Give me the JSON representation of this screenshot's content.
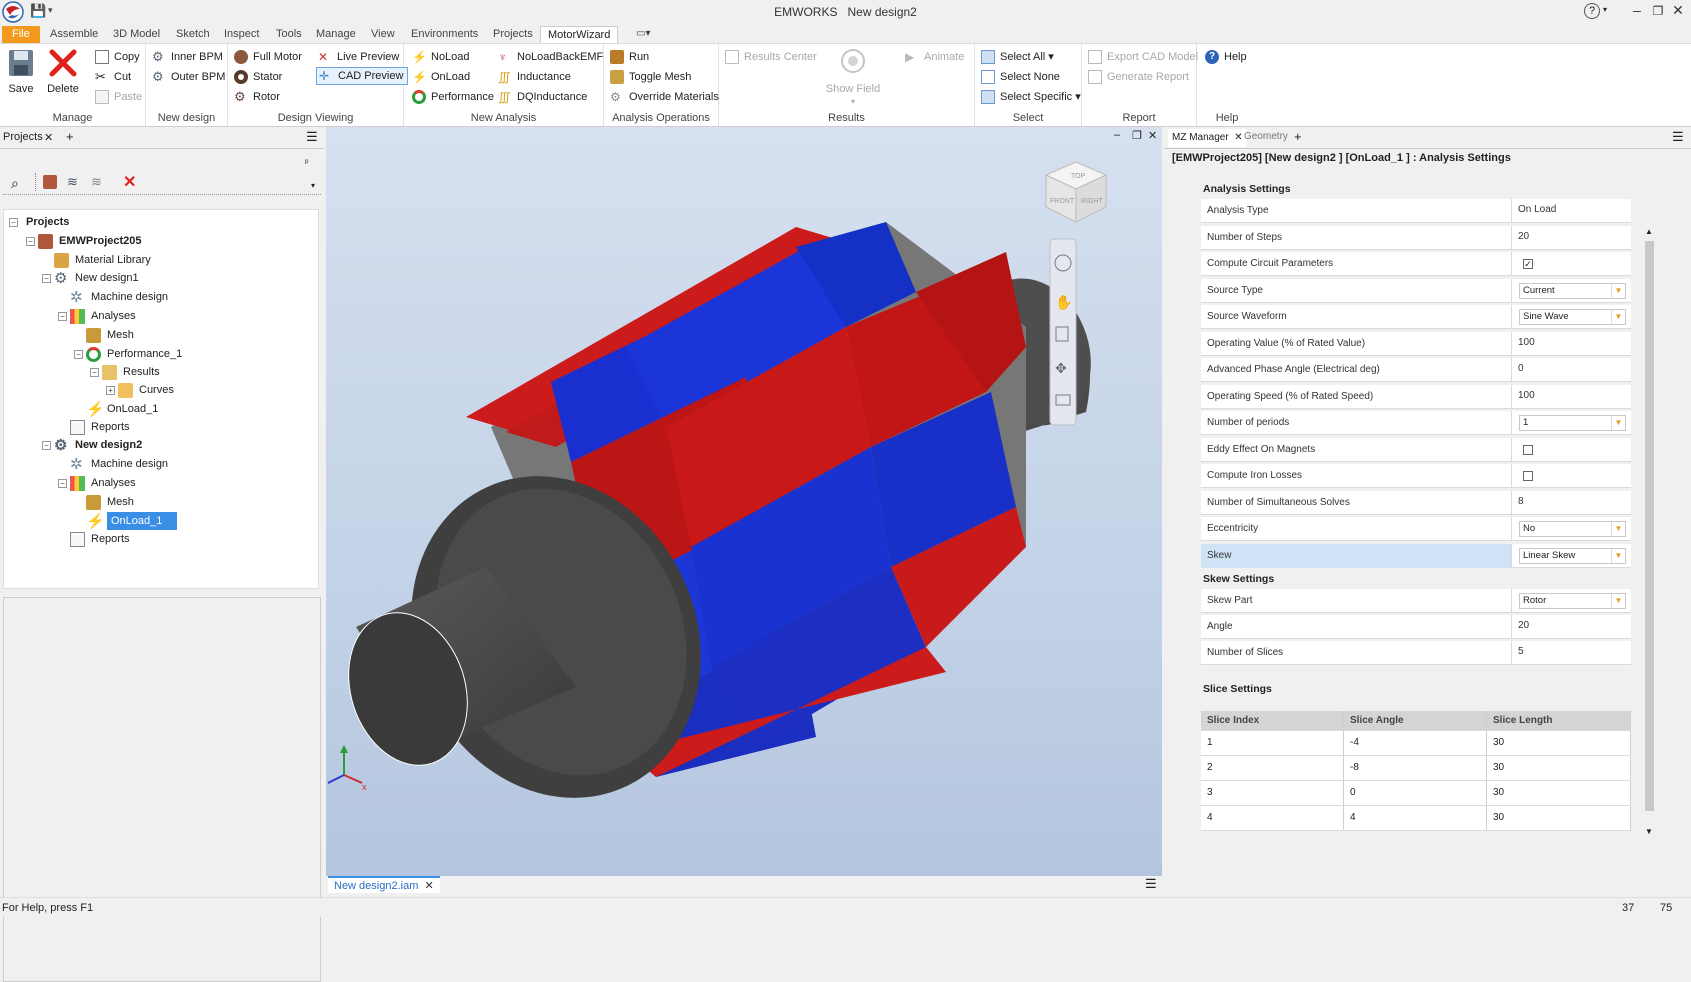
{
  "titlebar": {
    "app": "EMWORKS",
    "doc": "New design2",
    "help": "?"
  },
  "menu": {
    "file": "File",
    "tabs": [
      "Assemble",
      "3D Model",
      "Sketch",
      "Inspect",
      "Tools",
      "Manage",
      "View",
      "Environments",
      "Projects"
    ],
    "active": "MotorWizard"
  },
  "ribbon": {
    "manage": {
      "label": "Manage",
      "save": "Save",
      "delete": "Delete",
      "copy": "Copy",
      "cut": "Cut",
      "paste": "Paste"
    },
    "new_design": {
      "label": "New design",
      "inner": "Inner BPM",
      "outer": "Outer BPM"
    },
    "design_viewing": {
      "label": "Design Viewing",
      "full_motor": "Full Motor",
      "stator": "Stator",
      "rotor": "Rotor",
      "live_preview": "Live Preview",
      "cad_preview": "CAD Preview"
    },
    "new_analysis": {
      "label": "New Analysis",
      "noload": "NoLoad",
      "onload": "OnLoad",
      "performance": "Performance",
      "noloadbackemf": "NoLoadBackEMF",
      "inductance": "Inductance",
      "dqinductance": "DQInductance"
    },
    "analysis_ops": {
      "label": "Analysis Operations",
      "run": "Run",
      "toggle_mesh": "Toggle Mesh",
      "override": "Override Materials"
    },
    "results": {
      "label": "Results",
      "results_center": "Results Center",
      "show_field": "Show Field",
      "animate": "Animate"
    },
    "select": {
      "label": "Select",
      "all": "Select All",
      "none": "Select None",
      "specific": "Select Specific"
    },
    "report": {
      "label": "Report",
      "export": "Export CAD Model",
      "generate": "Generate Report"
    },
    "help": {
      "label": "Help",
      "help": "Help"
    }
  },
  "left": {
    "tab": "Projects",
    "tree": {
      "root": "Projects",
      "project": "EMWProject205",
      "material": "Material Library",
      "d1": "New design1",
      "machine": "Machine design",
      "analyses": "Analyses",
      "mesh": "Mesh",
      "perf": "Performance_1",
      "results": "Results",
      "curves": "Curves",
      "onload": "OnLoad_1",
      "reports": "Reports",
      "d2": "New design2"
    }
  },
  "viewport": {
    "doc_tab": "New design2.iam",
    "cube_top": "TOP",
    "cube_front": "FRONT",
    "cube_right": "RIGHT"
  },
  "right": {
    "tab1": "MZ Manager",
    "tab2": "Geometry",
    "header": "[EMWProject205] [New design2 ] [OnLoad_1 ] : Analysis Settings",
    "analysis_title": "Analysis Settings",
    "rows": [
      {
        "label": "Analysis Type",
        "value": "On Load"
      },
      {
        "label": "Number of Steps",
        "value": "20"
      },
      {
        "label": "Compute Circuit Parameters",
        "value": "✓"
      },
      {
        "label": "Source Type",
        "value": "Current"
      },
      {
        "label": "Source Waveform",
        "value": "Sine Wave"
      },
      {
        "label": "Operating Value (% of Rated Value)",
        "value": "100"
      },
      {
        "label": "Advanced Phase Angle (Electrical deg)",
        "value": "0"
      },
      {
        "label": "Operating Speed (% of Rated Speed)",
        "value": "100"
      },
      {
        "label": "Number of periods",
        "value": "1"
      },
      {
        "label": "Eddy Effect On Magnets",
        "value": ""
      },
      {
        "label": "Compute Iron Losses",
        "value": ""
      },
      {
        "label": "Number of Simultaneous Solves",
        "value": "8"
      },
      {
        "label": "Eccentricity",
        "value": "No"
      },
      {
        "label": "Skew",
        "value": "Linear Skew"
      }
    ],
    "skew_title": "Skew Settings",
    "skew_rows": [
      {
        "label": "Skew Part",
        "value": "Rotor"
      },
      {
        "label": "Angle",
        "value": "20"
      },
      {
        "label": "Number of Slices",
        "value": "5"
      }
    ],
    "slice_title": "Slice Settings",
    "slice_headers": [
      "Slice Index",
      "Slice Angle",
      "Slice Length"
    ],
    "slices": [
      [
        "1",
        "-4",
        "30"
      ],
      [
        "2",
        "-8",
        "30"
      ],
      [
        "3",
        "0",
        "30"
      ],
      [
        "4",
        "4",
        "30"
      ]
    ]
  },
  "status": {
    "help": "For Help, press F1",
    "n1": "37",
    "n2": "75"
  }
}
